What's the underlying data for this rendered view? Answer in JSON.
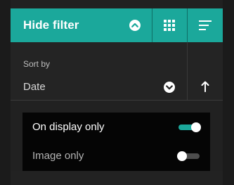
{
  "header": {
    "hide_filter_label": "Hide filter",
    "toggle_icon": "chevron-up-circle-icon",
    "grid_icon": "grid-icon",
    "list_icon": "list-icon",
    "accent_color": "#1ba89b"
  },
  "sort": {
    "label": "Sort by",
    "value": "Date",
    "dropdown_icon": "chevron-down-circle-icon",
    "direction_icon": "arrow-up-icon"
  },
  "filters": [
    {
      "label": "On display only",
      "on": true
    },
    {
      "label": "Image only",
      "on": false
    }
  ]
}
